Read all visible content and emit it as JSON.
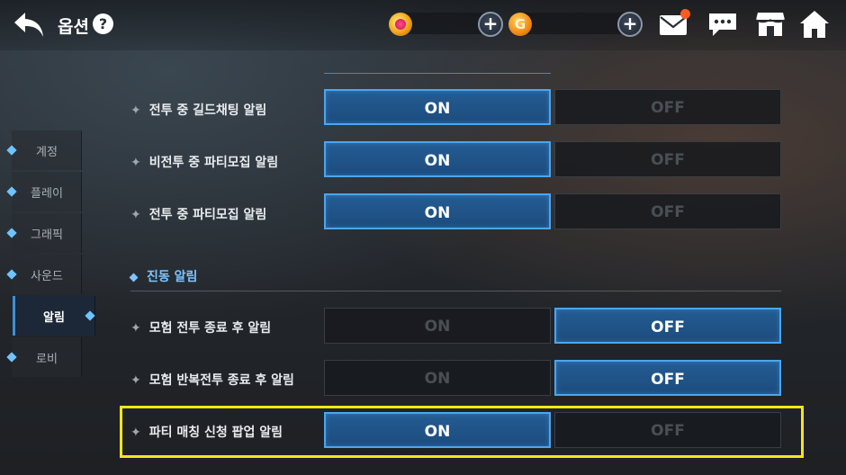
{
  "header": {
    "title": "옵션",
    "help_label": "?",
    "gold_symbol": "G",
    "plus_label": "+"
  },
  "sidebar": {
    "items": [
      {
        "label": "계정"
      },
      {
        "label": "플레이"
      },
      {
        "label": "그래픽"
      },
      {
        "label": "사운드"
      },
      {
        "label": "알림",
        "active": true
      },
      {
        "label": "로비"
      }
    ]
  },
  "settings": {
    "rows": [
      {
        "label": "전투 중 길드채팅 알림",
        "on_label": "ON",
        "off_label": "OFF",
        "value": "ON"
      },
      {
        "label": "비전투 중 파티모집 알림",
        "on_label": "ON",
        "off_label": "OFF",
        "value": "ON"
      },
      {
        "label": "전투 중 파티모집 알림",
        "on_label": "ON",
        "off_label": "OFF",
        "value": "ON"
      }
    ],
    "vibration_section": {
      "title": "진동 알림",
      "rows": [
        {
          "label": "모험 전투 종료 후 알림",
          "on_label": "ON",
          "off_label": "OFF",
          "value": "OFF"
        },
        {
          "label": "모험 반복전투 종료 후 알림",
          "on_label": "ON",
          "off_label": "OFF",
          "value": "OFF"
        },
        {
          "label": "파티 매칭 신청 팝업 알림",
          "on_label": "ON",
          "off_label": "OFF",
          "value": "ON",
          "highlighted": true
        }
      ]
    }
  },
  "colors": {
    "accent_blue": "#4aa6ef",
    "highlight_yellow": "#f6e51a",
    "mail_badge": "#ff5a1f"
  }
}
